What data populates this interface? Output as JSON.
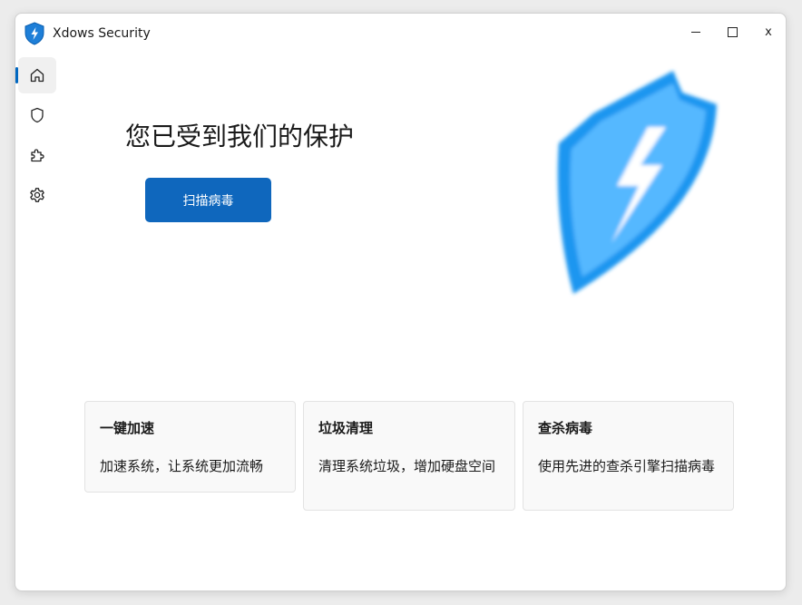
{
  "window": {
    "title": "Xdows Security",
    "controls": {
      "minimize_icon": "minimize-icon",
      "maximize_icon": "maximize-icon",
      "close_label": "x"
    }
  },
  "nav": {
    "items": [
      {
        "id": "home",
        "icon": "home-icon",
        "selected": true
      },
      {
        "id": "protection",
        "icon": "shield-icon",
        "selected": false
      },
      {
        "id": "extensions",
        "icon": "puzzle-icon",
        "selected": false
      },
      {
        "id": "settings",
        "icon": "gear-icon",
        "selected": false
      }
    ]
  },
  "main": {
    "headline": "您已受到我们的保护",
    "scan_button_label": "扫描病毒"
  },
  "cards": [
    {
      "title": "一键加速",
      "description": "加速系统，让系统更加流畅"
    },
    {
      "title": "垃圾清理",
      "description": "清理系统垃圾，增加硬盘空间"
    },
    {
      "title": "查杀病毒",
      "description": "使用先进的查杀引擎扫描病毒"
    }
  ],
  "colors": {
    "accent": "#0f67bd",
    "shield_blue": "#1e90ff",
    "shield_light": "#4db8ff"
  }
}
